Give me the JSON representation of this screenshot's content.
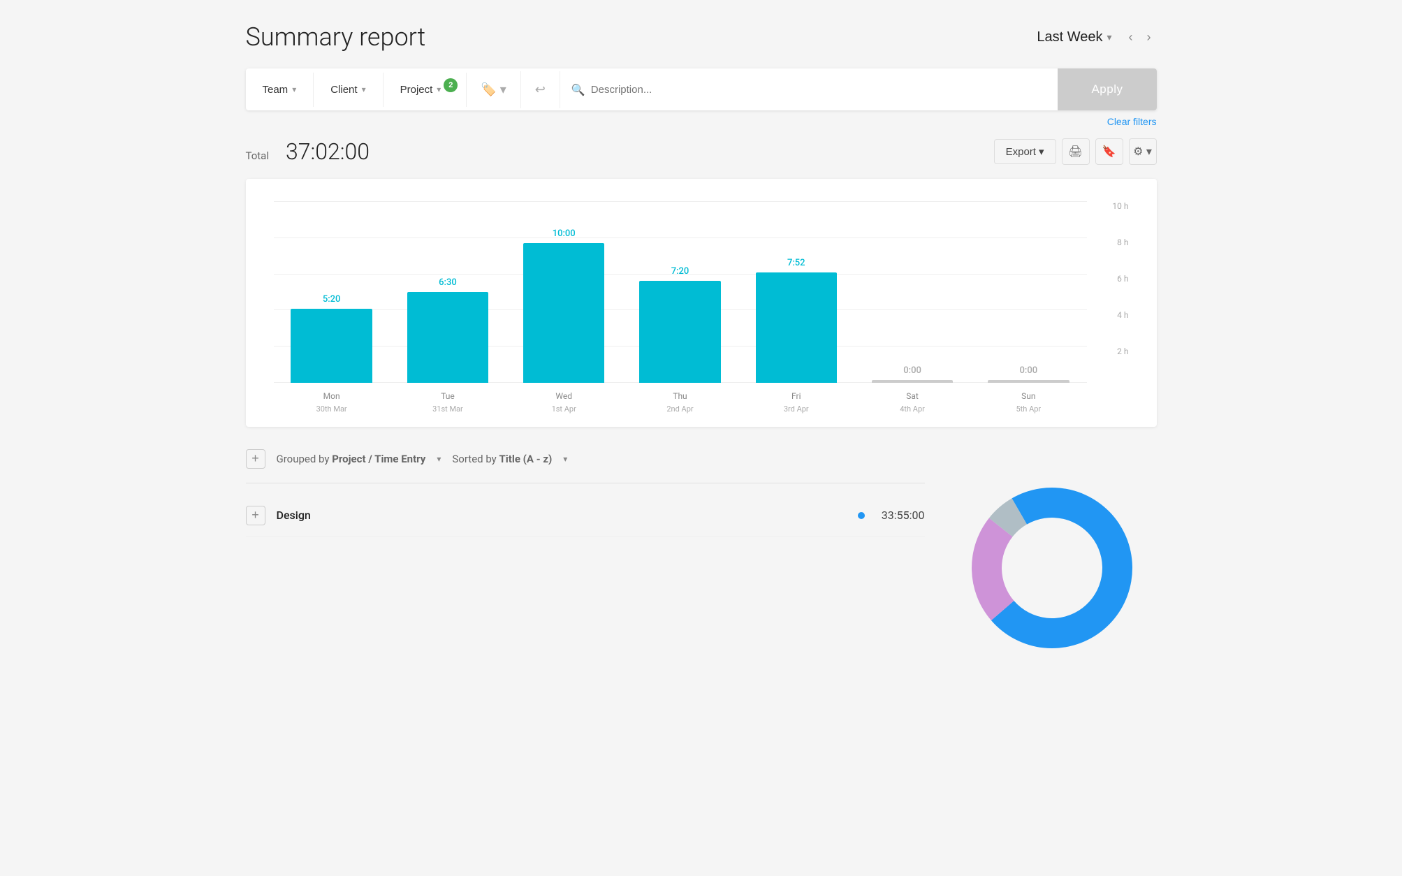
{
  "header": {
    "title": "Summary report",
    "date_range": "Last Week",
    "nav_prev": "‹",
    "nav_next": "›"
  },
  "filters": {
    "team_label": "Team",
    "client_label": "Client",
    "project_label": "Project",
    "project_badge": "2",
    "tags_icon": "🏷",
    "billable_icon": "↩",
    "search_placeholder": "Description...",
    "apply_label": "Apply",
    "clear_filters_label": "Clear filters"
  },
  "summary": {
    "total_label": "Total",
    "total_time": "37:02:00",
    "export_label": "Export",
    "export_chevron": "▾",
    "print_icon": "🖨",
    "bookmark_icon": "🔖",
    "settings_icon": "⚙"
  },
  "chart": {
    "y_labels": [
      "10 h",
      "8 h",
      "6 h",
      "4 h",
      "2 h",
      ""
    ],
    "bars": [
      {
        "day": "Mon",
        "date": "30th Mar",
        "value": "5:20",
        "height_pct": 53,
        "zero": false
      },
      {
        "day": "Tue",
        "date": "31st Mar",
        "value": "6:30",
        "height_pct": 65,
        "zero": false
      },
      {
        "day": "Wed",
        "date": "1st Apr",
        "value": "10:00",
        "height_pct": 100,
        "zero": false
      },
      {
        "day": "Thu",
        "date": "2nd Apr",
        "value": "7:20",
        "height_pct": 73,
        "zero": false
      },
      {
        "day": "Fri",
        "date": "3rd Apr",
        "value": "7:52",
        "height_pct": 79,
        "zero": false
      },
      {
        "day": "Sat",
        "date": "4th Apr",
        "value": "0:00",
        "height_pct": 0,
        "zero": true
      },
      {
        "day": "Sun",
        "date": "5th Apr",
        "value": "0:00",
        "height_pct": 0,
        "zero": true
      }
    ]
  },
  "grouping": {
    "add_icon": "+",
    "grouped_by_label": "Grouped by",
    "grouped_by_value": "Project / Time Entry",
    "sorted_by_label": "Sorted by",
    "sorted_by_value": "Title (A - z)"
  },
  "data_rows": [
    {
      "name": "Design",
      "dot_color": "#2196F3",
      "time": "33:55:00"
    }
  ],
  "donut": {
    "segments": [
      {
        "color": "#2196F3",
        "pct": 75
      },
      {
        "color": "#CE93D8",
        "pct": 20
      },
      {
        "color": "#B0BEC5",
        "pct": 5
      }
    ]
  }
}
